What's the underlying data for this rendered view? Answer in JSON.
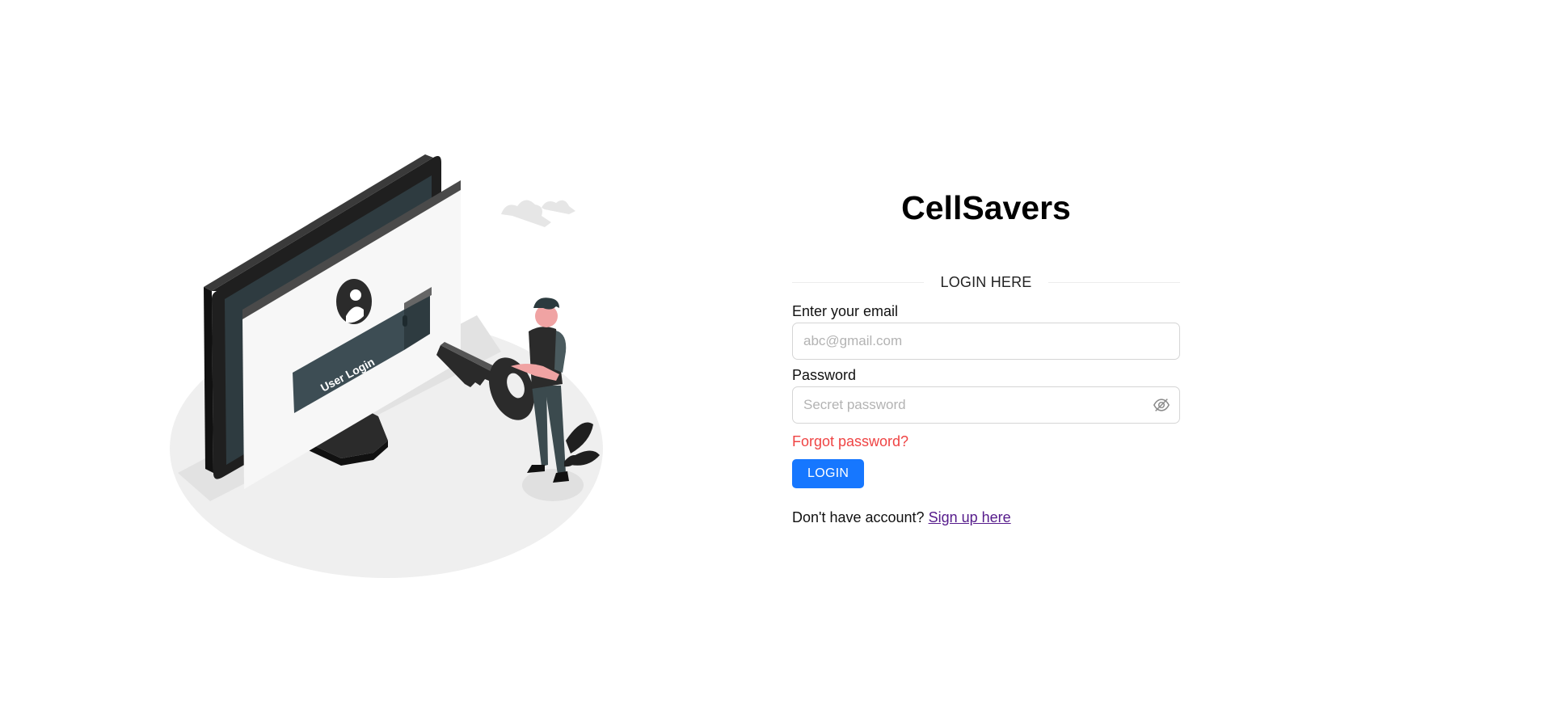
{
  "app": {
    "title": "CellSavers"
  },
  "illustration": {
    "screen_button_text": "User Login"
  },
  "login": {
    "heading": "LOGIN HERE",
    "email_label": "Enter your email",
    "email_placeholder": "abc@gmail.com",
    "email_value": "",
    "password_label": "Password",
    "password_placeholder": "Secret password",
    "password_value": "",
    "password_toggle_icon": "eye-slash-icon",
    "forgot_password": "Forgot password?",
    "submit_label": "LOGIN",
    "signup_prompt": "Don't have account?",
    "signup_link": "Sign up here"
  },
  "colors": {
    "primary_button": "#1677ff",
    "forgot_link": "#ef4444",
    "signup_link": "#551a8b"
  }
}
